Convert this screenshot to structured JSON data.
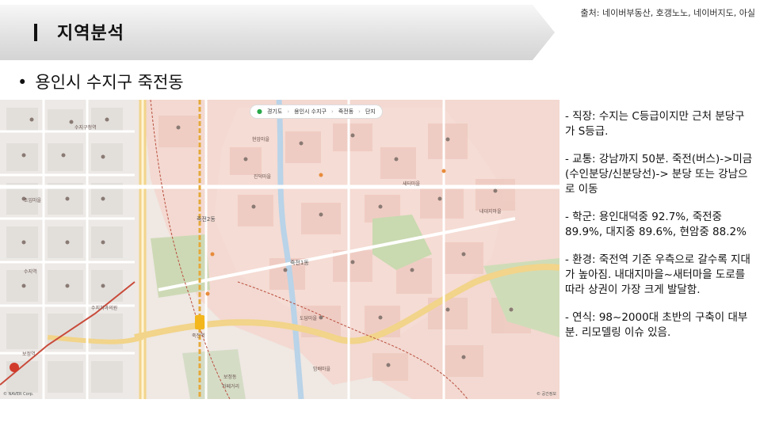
{
  "header": {
    "section_title": "지역분석",
    "source": "출처: 네이버부동산, 호갱노노, 네이버지도, 아실"
  },
  "subtitle": {
    "bullet": "•",
    "text": "용인시 수지구 죽전동"
  },
  "map": {
    "breadcrumb": [
      "경기도",
      "용인시 수지구",
      "죽전동",
      "단지"
    ],
    "labels": {
      "jukjeon2": "죽전2동",
      "jukjeon1": "죽전1동",
      "jukjeon_station": "죽전역",
      "hyeonammaeul": "현암마을",
      "jindeokmaeul": "진덕마을",
      "saeteomaeul": "새터마을",
      "naedaejimaeul": "내대지마을",
      "domaeul": "도담마을",
      "bambaemaeul": "밤배마을",
      "bojeongdong": "보정동",
      "cafe_street": "카페거리",
      "sujigusi": "수지구청역",
      "chogimaeul": "초입마을",
      "sujiyeok": "수지역",
      "sujiguchinlyo": "수지치과의원",
      "bojeongyeok": "보정역"
    },
    "copyright": "© NAVER Corp.",
    "scale": "© 공간정보"
  },
  "notes": [
    "- 직장: 수지는 C등급이지만 근처 분당구가 S등급.",
    "- 교통: 강남까지 50분. 죽전(버스)->미금(수인분당/신분당선)-> 분당 또는 강남으로 이동",
    "- 학군: 용인대덕중 92.7%, 죽전중 89.9%, 대지중 89.6%, 현암중 88.2%",
    "- 환경: 죽전역 기준 우측으로 갈수록 지대가 높아짐. 내대지마을~새터마을 도로를 따라 상권이 가장 크게 발달함.",
    "- 연식: 98~2000대 초반의 구축이 대부분. 리모델링 이슈 있음."
  ],
  "colors": {
    "map_pink": "#f3ddd6",
    "map_base": "#f1ece7",
    "road_yellow": "#f2d48a",
    "river_blue": "#b9d3e8",
    "park_green": "#c9d9b0",
    "rail": "#e5a93a"
  }
}
